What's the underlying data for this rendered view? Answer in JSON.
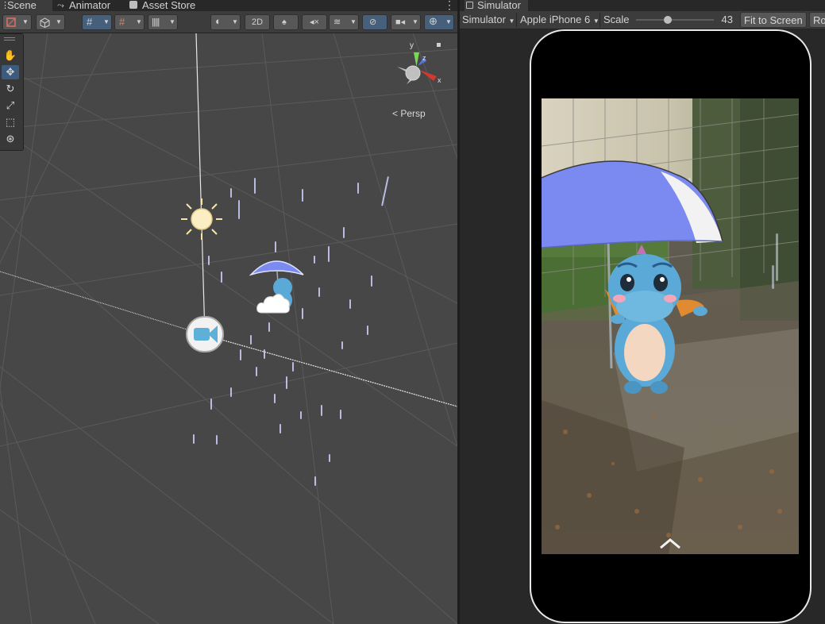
{
  "scene_panel": {
    "tabs": [
      {
        "label": "Scene",
        "active": true
      },
      {
        "label": "Animator",
        "active": false
      },
      {
        "label": "Asset Store",
        "active": false
      }
    ],
    "toolbar": {
      "mode_2d_label": "2D"
    },
    "tools": [
      "hand",
      "move",
      "rotate",
      "scale",
      "rect",
      "transform"
    ],
    "active_tool": "move",
    "gizmo": {
      "axis_x": "x",
      "axis_y": "y",
      "axis_z": "z",
      "projection_label": "Persp"
    }
  },
  "simulator_panel": {
    "tab_label": "Simulator",
    "toolbar": {
      "view_select": "Simulator",
      "device_select": "Apple iPhone 6",
      "scale_label": "Scale",
      "scale_value": "43",
      "scale_fraction": 0.4,
      "fit_button": "Fit to Screen",
      "rotate_button": "Ro"
    }
  },
  "colors": {
    "accent_blue": "#46607c",
    "selected_tool": "#3c5b7e",
    "scene_background": "#474747",
    "umbrella_blue": "#7b8af0",
    "dragon_blue": "#5aa9d6",
    "sun_yellow": "#f7e6a8"
  }
}
